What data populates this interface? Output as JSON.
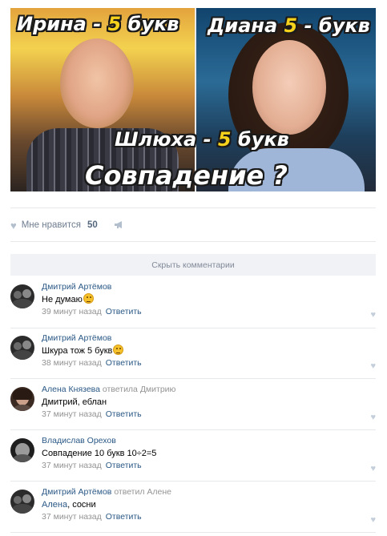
{
  "post": {
    "image": {
      "top_left_caption_name": "Ирина",
      "top_left_caption_rest": " - ",
      "top_left_caption_num": "5",
      "top_left_caption_word": " букв",
      "top_right_caption_name": "Диана ",
      "top_right_caption_num": "5",
      "top_right_caption_word": " - букв",
      "middle_caption_word": "Шлюха",
      "middle_caption_rest": " - ",
      "middle_caption_num": "5",
      "middle_caption_tail": " букв",
      "bottom_caption": "Совпадение ?"
    },
    "likes": {
      "label": "Мне нравится",
      "count": "50",
      "heart_icon": "heart-icon",
      "share_icon": "megaphone-icon"
    },
    "hide_comments_label": "Скрыть комментарии"
  },
  "comments": [
    {
      "author": "Дмитрий Артёмов",
      "replied": "",
      "text": "Не думаю",
      "emoji": "thinking-emoji",
      "time": "39 минут назад",
      "reply": "Ответить"
    },
    {
      "author": "Дмитрий Артёмов",
      "replied": "",
      "text": "Шкура тож 5 букв",
      "emoji": "laughing-emoji",
      "time": "38 минут назад",
      "reply": "Ответить"
    },
    {
      "author": "Алена Князева",
      "replied": "ответила Дмитрию",
      "text": "Дмитрий, еблан",
      "time": "37 минут назад",
      "reply": "Ответить"
    },
    {
      "author": "Владислав Орехов",
      "replied": "",
      "text": "Совпадение 10 букв 10÷2=5",
      "time": "37 минут назад",
      "reply": "Ответить"
    },
    {
      "author": "Дмитрий Артёмов",
      "replied": "ответил Алене",
      "text_link": "Алена",
      "text": ", сосни",
      "time": "37 минут назад",
      "reply": "Ответить"
    }
  ],
  "colors": {
    "link": "#2a5885",
    "meta": "#939393",
    "separator": "#e7e8ec",
    "hide_bar": "#f0f2f5"
  }
}
